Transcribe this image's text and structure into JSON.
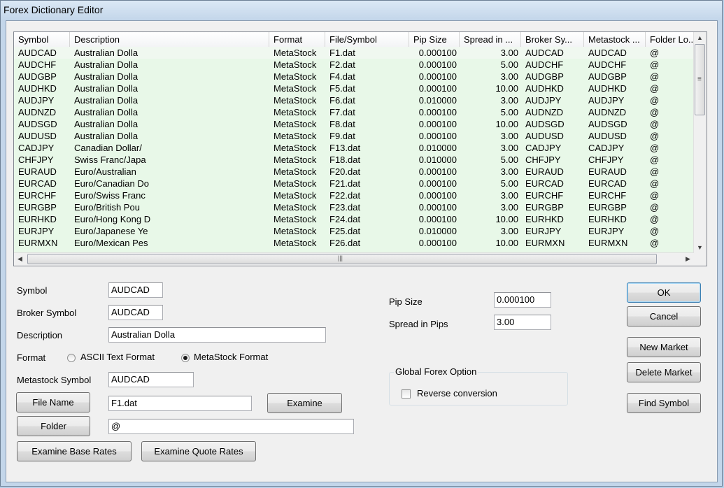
{
  "window": {
    "title": "Forex Dictionary Editor"
  },
  "table": {
    "columns": [
      "Symbol",
      "Description",
      "Format",
      "File/Symbol",
      "Pip Size",
      "Spread in ...",
      "Broker Sy...",
      "Metastock ...",
      "Folder Lo..."
    ],
    "rows": [
      [
        "AUDCAD",
        "Australian Dolla",
        "MetaStock",
        "F1.dat",
        "0.000100",
        "3.00",
        "AUDCAD",
        "AUDCAD",
        "@"
      ],
      [
        "AUDCHF",
        "Australian Dolla",
        "MetaStock",
        "F2.dat",
        "0.000100",
        "5.00",
        "AUDCHF",
        "AUDCHF",
        "@"
      ],
      [
        "AUDGBP",
        "Australian Dolla",
        "MetaStock",
        "F4.dat",
        "0.000100",
        "3.00",
        "AUDGBP",
        "AUDGBP",
        "@"
      ],
      [
        "AUDHKD",
        "Australian Dolla",
        "MetaStock",
        "F5.dat",
        "0.000100",
        "10.00",
        "AUDHKD",
        "AUDHKD",
        "@"
      ],
      [
        "AUDJPY",
        "Australian Dolla",
        "MetaStock",
        "F6.dat",
        "0.010000",
        "3.00",
        "AUDJPY",
        "AUDJPY",
        "@"
      ],
      [
        "AUDNZD",
        "Australian Dolla",
        "MetaStock",
        "F7.dat",
        "0.000100",
        "5.00",
        "AUDNZD",
        "AUDNZD",
        "@"
      ],
      [
        "AUDSGD",
        "Australian Dolla",
        "MetaStock",
        "F8.dat",
        "0.000100",
        "10.00",
        "AUDSGD",
        "AUDSGD",
        "@"
      ],
      [
        "AUDUSD",
        "Australian Dolla",
        "MetaStock",
        "F9.dat",
        "0.000100",
        "3.00",
        "AUDUSD",
        "AUDUSD",
        "@"
      ],
      [
        "CADJPY",
        "Canadian Dollar/",
        "MetaStock",
        "F13.dat",
        "0.010000",
        "3.00",
        "CADJPY",
        "CADJPY",
        "@"
      ],
      [
        "CHFJPY",
        "Swiss Franc/Japa",
        "MetaStock",
        "F18.dat",
        "0.010000",
        "5.00",
        "CHFJPY",
        "CHFJPY",
        "@"
      ],
      [
        "EURAUD",
        "Euro/Australian",
        "MetaStock",
        "F20.dat",
        "0.000100",
        "3.00",
        "EURAUD",
        "EURAUD",
        "@"
      ],
      [
        "EURCAD",
        "Euro/Canadian Do",
        "MetaStock",
        "F21.dat",
        "0.000100",
        "5.00",
        "EURCAD",
        "EURCAD",
        "@"
      ],
      [
        "EURCHF",
        "Euro/Swiss Franc",
        "MetaStock",
        "F22.dat",
        "0.000100",
        "3.00",
        "EURCHF",
        "EURCHF",
        "@"
      ],
      [
        "EURGBP",
        "Euro/British Pou",
        "MetaStock",
        "F23.dat",
        "0.000100",
        "3.00",
        "EURGBP",
        "EURGBP",
        "@"
      ],
      [
        "EURHKD",
        "Euro/Hong Kong D",
        "MetaStock",
        "F24.dat",
        "0.000100",
        "10.00",
        "EURHKD",
        "EURHKD",
        "@"
      ],
      [
        "EURJPY",
        "Euro/Japanese Ye",
        "MetaStock",
        "F25.dat",
        "0.010000",
        "3.00",
        "EURJPY",
        "EURJPY",
        "@"
      ],
      [
        "EURMXN",
        "Euro/Mexican Pes",
        "MetaStock",
        "F26.dat",
        "0.000100",
        "10.00",
        "EURMXN",
        "EURMXN",
        "@"
      ]
    ],
    "row_color": "#e8f8e8",
    "scrollbar_grip_v": "≡",
    "scrollbar_grip_h": "|||",
    "arrow_up": "▲",
    "arrow_down": "▼",
    "arrow_left": "◀",
    "arrow_right": "▶"
  },
  "form": {
    "symbol_label": "Symbol",
    "symbol_value": "AUDCAD",
    "broker_label": "Broker Symbol",
    "broker_value": "AUDCAD",
    "description_label": "Description",
    "description_value": "Australian Dolla",
    "format_label": "Format",
    "format_ascii": "ASCII Text Format",
    "format_metastock": "MetaStock Format",
    "metastock_label": "Metastock Symbol",
    "metastock_value": "AUDCAD",
    "file_name_button": "File Name",
    "file_name_value": "F1.dat",
    "examine_button": "Examine",
    "folder_button": "Folder",
    "folder_value": "@",
    "examine_base_button": "Examine Base Rates",
    "examine_quote_button": "Examine  Quote Rates",
    "pip_label": "Pip Size",
    "pip_value": "0.000100",
    "spread_label": "Spread in Pips",
    "spread_value": "3.00",
    "global_group": "Global Forex Option",
    "reverse_label": "Reverse conversion"
  },
  "buttons": {
    "ok": "OK",
    "cancel": "Cancel",
    "new_market": "New Market",
    "delete_market": "Delete Market",
    "find_symbol": "Find Symbol"
  }
}
